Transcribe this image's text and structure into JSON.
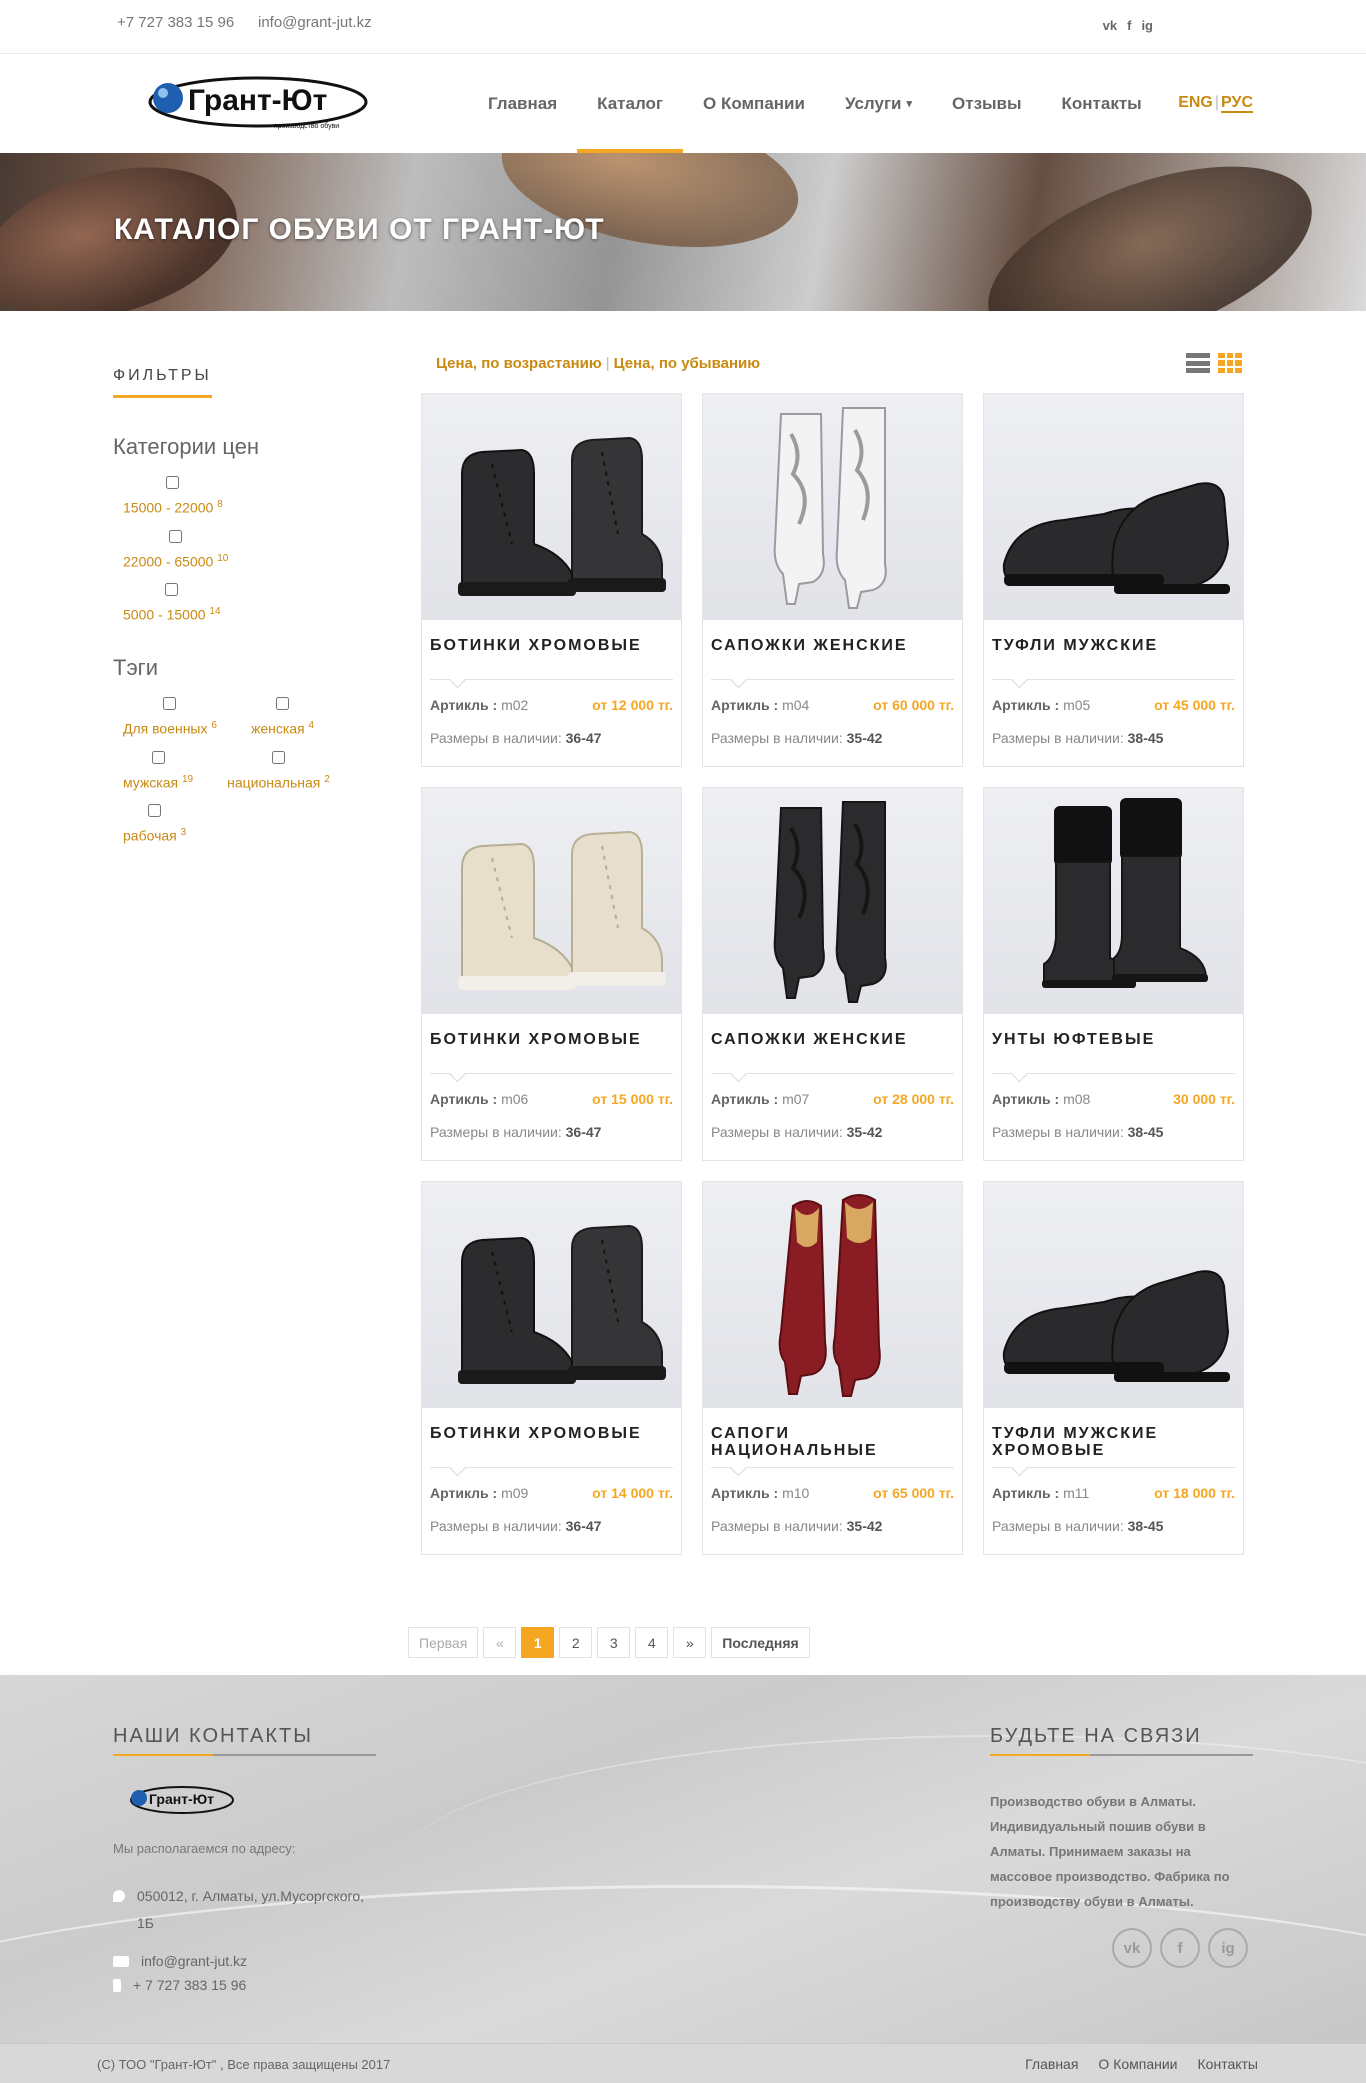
{
  "topbar": {
    "phone": "+7 727 383 15 96",
    "email": "info@grant-jut.kz",
    "social": [
      "vk",
      "f",
      "ig"
    ]
  },
  "logo": {
    "name": "Грант-Ют",
    "tagline": "производство обуви"
  },
  "nav": {
    "items": [
      "Главная",
      "Каталог",
      "О Компании",
      "Услуги",
      "Отзывы",
      "Контакты"
    ],
    "active": "Каталог",
    "dropdown_caret": "▾",
    "lang_eng": "ENG",
    "lang_rus": "РУС"
  },
  "banner": {
    "title": "КАТАЛОГ ОБУВИ ОТ ГРАНТ-ЮТ"
  },
  "filters": {
    "title": "ФИЛЬТРЫ",
    "price_title": "Категории цен",
    "price": [
      {
        "label": "15000 - 22000",
        "count": "8"
      },
      {
        "label": "22000 - 65000",
        "count": "10"
      },
      {
        "label": "5000 - 15000",
        "count": "14"
      }
    ],
    "tags_title": "Тэги",
    "tags": [
      {
        "label": "Для военных",
        "count": "6"
      },
      {
        "label": "женская",
        "count": "4"
      },
      {
        "label": "мужская",
        "count": "19"
      },
      {
        "label": "национальная",
        "count": "2"
      },
      {
        "label": "рабочая",
        "count": "3"
      }
    ]
  },
  "sort": {
    "asc": "Цена, по возрастанию",
    "desc": "Цена, по убыванию",
    "sep": "|"
  },
  "labels": {
    "article": "Артикль :",
    "sizes": "Размеры в наличии:"
  },
  "products": [
    {
      "title": "БОТИНКИ ХРОМОВЫЕ",
      "article": "m02",
      "price": "от 12 000 тг.",
      "sizes": "36-47",
      "shoe": "boot-black",
      "colors": [
        "#2c2c2e",
        "#111111"
      ]
    },
    {
      "title": "САПОЖКИ ЖЕНСКИЕ",
      "article": "m04",
      "price": "от 60 000 тг.",
      "sizes": "35-42",
      "shoe": "tall-boot",
      "colors": [
        "#f3f3f3",
        "#9a9aa0"
      ]
    },
    {
      "title": "ТУФЛИ МУЖСКИЕ",
      "article": "m05",
      "price": "от 45 000 тг.",
      "sizes": "38-45",
      "shoe": "loafer",
      "colors": [
        "#2a2a2c",
        "#111111"
      ]
    },
    {
      "title": "БОТИНКИ ХРОМОВЫЕ",
      "article": "m06",
      "price": "от 15 000 тг.",
      "sizes": "36-47",
      "shoe": "boot-beige",
      "colors": [
        "#e7dfcc",
        "#b7ad92"
      ]
    },
    {
      "title": "САПОЖКИ ЖЕНСКИЕ",
      "article": "m07",
      "price": "от 28 000 тг.",
      "sizes": "35-42",
      "shoe": "tall-boot",
      "colors": [
        "#2b2b2d",
        "#151515"
      ]
    },
    {
      "title": "УНТЫ ЮФТЕВЫЕ",
      "article": "m08",
      "price": "30 000 тг.",
      "sizes": "38-45",
      "shoe": "fur-boot",
      "colors": [
        "#2b2b2d",
        "#151515"
      ]
    },
    {
      "title": "БОТИНКИ ХРОМОВЫЕ",
      "article": "m09",
      "price": "от 14 000 тг.",
      "sizes": "36-47",
      "shoe": "boot-black",
      "colors": [
        "#2c2c2e",
        "#111111"
      ]
    },
    {
      "title": "САПОГИ НАЦИОНАЛЬНЫЕ",
      "article": "m10",
      "price": "от 65 000 тг.",
      "sizes": "35-42",
      "shoe": "national-boot",
      "colors": [
        "#8a1c24",
        "#d8a860"
      ]
    },
    {
      "title": "ТУФЛИ МУЖСКИЕ ХРОМОВЫЕ",
      "article": "m11",
      "price": "от 18 000 тг.",
      "sizes": "38-45",
      "shoe": "loafer",
      "colors": [
        "#2a2a2c",
        "#111111"
      ]
    }
  ],
  "pagination": {
    "first": "Первая",
    "prev": "«",
    "pages": [
      "1",
      "2",
      "3",
      "4"
    ],
    "next": "»",
    "last": "Последняя",
    "current": "1"
  },
  "footer": {
    "contacts_title": "НАШИ КОНТАКТЫ",
    "address_label": "Мы располагаемся по адресу:",
    "address": "050012, г. Алматы, ул.Мусоргского, 1Б",
    "email": "info@grant-jut.kz",
    "phone": "+ 7 727 383 15 96",
    "social_title": "БУДЬТЕ НА СВЯЗИ",
    "about": "Производство обуви в Алматы. Индивидуальный пошив обуви в Алматы. Принимаем заказы на массовое производство. Фабрика по производству обуви в Алматы.",
    "social": [
      "vk",
      "f",
      "ig"
    ]
  },
  "copyright": {
    "text": "(C) ТОО \"Грант-Ют\" , Все права защищены 2017",
    "links": [
      "Главная",
      "О Компании",
      "Контакты"
    ]
  },
  "colors": {
    "accent": "#f5a623",
    "accent_dark": "#c98a12"
  }
}
